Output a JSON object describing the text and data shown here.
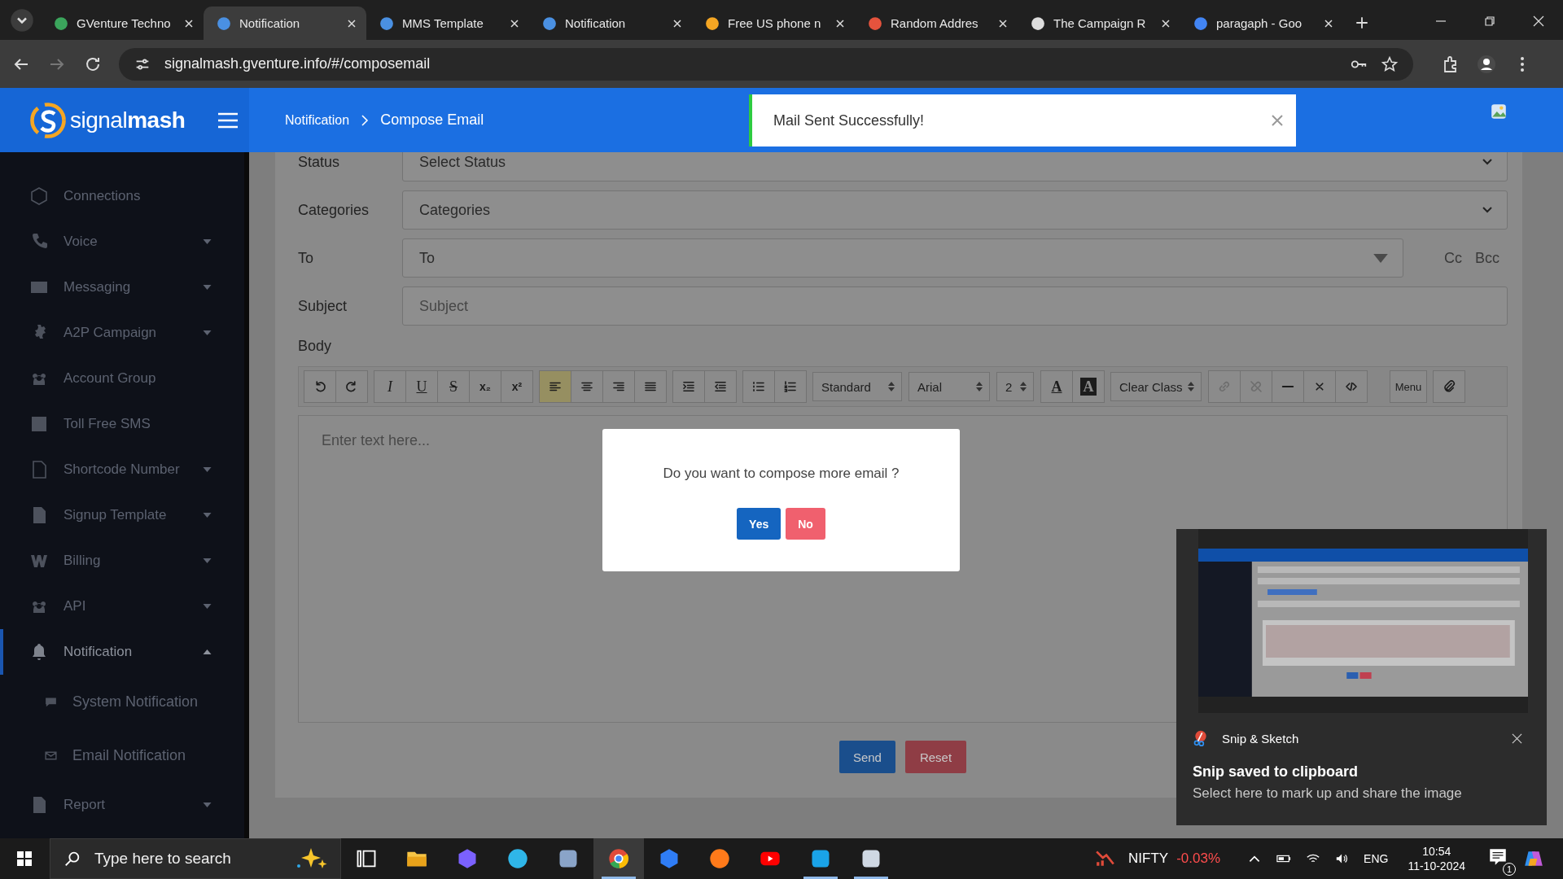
{
  "browser": {
    "tabs": [
      {
        "title": "GVenture Techno",
        "selected": false
      },
      {
        "title": "Notification",
        "selected": true
      },
      {
        "title": "MMS Template",
        "selected": false
      },
      {
        "title": "Notification",
        "selected": false
      },
      {
        "title": "Free US phone n",
        "selected": false
      },
      {
        "title": "Random Addres",
        "selected": false
      },
      {
        "title": "The Campaign R",
        "selected": false
      },
      {
        "title": "paragaph - Goo",
        "selected": false
      }
    ],
    "address": "signalmash.gventure.info/#/composemail"
  },
  "header": {
    "logo": "signal**mash**",
    "breadcrumb": [
      "Notification",
      "Compose Email"
    ]
  },
  "toast": {
    "message": "Mail Sent Successfully!"
  },
  "sidebar": {
    "items": [
      {
        "label": "Connections",
        "has_menu": false,
        "expanded": false,
        "selected": false
      },
      {
        "label": "Voice",
        "has_menu": true,
        "expanded": false,
        "selected": false
      },
      {
        "label": "Messaging",
        "has_menu": true,
        "expanded": false,
        "selected": false
      },
      {
        "label": "A2P Campaign",
        "has_menu": true,
        "expanded": false,
        "selected": false
      },
      {
        "label": "Account Group",
        "has_menu": false,
        "expanded": false,
        "selected": false
      },
      {
        "label": "Toll Free SMS",
        "has_menu": false,
        "expanded": false,
        "selected": false
      },
      {
        "label": "Shortcode Number",
        "has_menu": true,
        "expanded": false,
        "selected": false
      },
      {
        "label": "Signup Template",
        "has_menu": true,
        "expanded": false,
        "selected": false
      },
      {
        "label": "Billing",
        "has_menu": true,
        "expanded": false,
        "selected": false
      },
      {
        "label": "API",
        "has_menu": true,
        "expanded": false,
        "selected": false
      },
      {
        "label": "Notification",
        "has_menu": true,
        "expanded": true,
        "selected": true,
        "children": [
          {
            "label": "System Notification"
          },
          {
            "label": "Email Notification"
          }
        ]
      },
      {
        "label": "Report",
        "has_menu": true,
        "expanded": false,
        "selected": false
      }
    ]
  },
  "form": {
    "fields": [
      {
        "label": "Status",
        "kind": "select",
        "value": "Select Status"
      },
      {
        "label": "Categories",
        "kind": "select",
        "value": "Categories"
      },
      {
        "label": "To",
        "kind": "multiselect",
        "placeholder": "To",
        "links": [
          "Cc",
          "Bcc"
        ]
      },
      {
        "label": "Subject",
        "kind": "text",
        "placeholder": "Subject"
      }
    ],
    "body_label": "Body",
    "toolbar": [
      [
        {
          "kind": "undo",
          "selected": false,
          "disabled": false
        },
        {
          "kind": "redo",
          "selected": false,
          "disabled": false
        }
      ],
      [
        {
          "kind": "italic",
          "label": "I",
          "selected": false,
          "disabled": false
        },
        {
          "kind": "underline",
          "label": "U",
          "selected": false,
          "disabled": false
        },
        {
          "kind": "strike",
          "label": "S",
          "selected": false,
          "disabled": false
        },
        {
          "kind": "sub",
          "label": "x₂",
          "selected": false,
          "disabled": false
        },
        {
          "kind": "sup",
          "label": "x²",
          "selected": false,
          "disabled": false
        }
      ],
      [
        {
          "kind": "align-left",
          "selected": true,
          "disabled": false
        },
        {
          "kind": "align-center",
          "selected": false,
          "disabled": false
        },
        {
          "kind": "align-right",
          "selected": false,
          "disabled": false
        },
        {
          "kind": "justify",
          "selected": false,
          "disabled": false
        }
      ],
      [
        {
          "kind": "indent",
          "selected": false,
          "disabled": false
        },
        {
          "kind": "outdent",
          "selected": false,
          "disabled": false
        }
      ],
      [
        {
          "kind": "bullets",
          "selected": false,
          "disabled": false
        },
        {
          "kind": "numbers",
          "selected": false,
          "disabled": false
        }
      ],
      [
        {
          "kind": "select",
          "value": "Standard"
        }
      ],
      [
        {
          "kind": "select",
          "value": "Arial"
        }
      ],
      [
        {
          "kind": "select",
          "value": "2"
        }
      ],
      [
        {
          "kind": "color",
          "label": "A",
          "selected": false,
          "disabled": false
        },
        {
          "kind": "highlight",
          "label": "A",
          "selected": false,
          "disabled": false
        }
      ],
      [
        {
          "kind": "select",
          "value": "Clear Class"
        }
      ],
      [
        {
          "kind": "link",
          "selected": false,
          "disabled": true
        },
        {
          "kind": "unlink",
          "selected": false,
          "disabled": true
        },
        {
          "kind": "rule",
          "selected": false,
          "disabled": false
        },
        {
          "kind": "clear",
          "selected": false,
          "disabled": false
        },
        {
          "kind": "code",
          "selected": false,
          "disabled": false
        }
      ],
      [
        {
          "kind": "menu",
          "label": "Menu",
          "selected": false,
          "disabled": false
        }
      ],
      [
        {
          "kind": "attach",
          "selected": false,
          "disabled": false
        }
      ]
    ],
    "editor_placeholder": "Enter text here...",
    "buttons": [
      {
        "label": "Send",
        "kind": "primary"
      },
      {
        "label": "Reset",
        "kind": "danger"
      }
    ]
  },
  "dialog": {
    "message": "Do you want to compose more email ?",
    "buttons": [
      {
        "label": "Yes",
        "kind": "confirm"
      },
      {
        "label": "No",
        "kind": "cancel"
      }
    ]
  },
  "notification": {
    "app": "Snip & Sketch",
    "title": "Snip saved to clipboard",
    "body": "Select here to mark up and share the image"
  },
  "taskbar": {
    "search_placeholder": "Type here to search",
    "apps": [
      {
        "selected": false,
        "running": false
      },
      {
        "selected": false,
        "running": false
      },
      {
        "selected": false,
        "running": false
      },
      {
        "selected": false,
        "running": false
      },
      {
        "selected": false,
        "running": false
      },
      {
        "selected": true,
        "running": true
      },
      {
        "selected": false,
        "running": false
      },
      {
        "selected": false,
        "running": false
      },
      {
        "selected": false,
        "running": false
      },
      {
        "selected": false,
        "running": true
      },
      {
        "selected": false,
        "running": true
      }
    ],
    "ticker": {
      "name": "NIFTY",
      "change": "-0.03%"
    },
    "language": "ENG",
    "time": "10:54",
    "date": "11-10-2024",
    "notification_count": "1"
  }
}
